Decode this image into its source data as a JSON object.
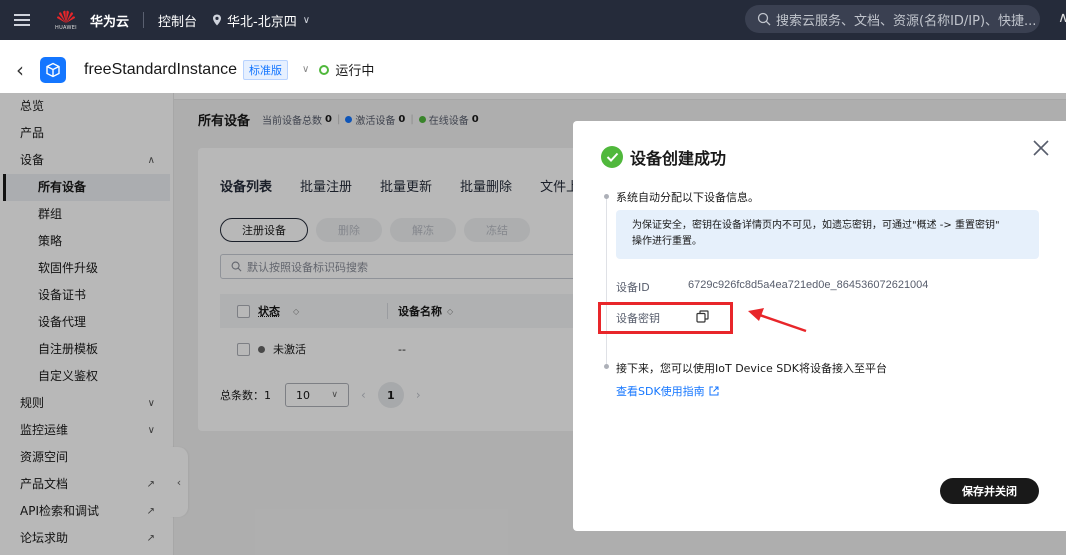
{
  "topbar": {
    "brand": "华为云",
    "logo_text": "HUAWEI",
    "console": "控制台",
    "region": "华北-北京四",
    "search_placeholder": "搜索云服务、文档、资源(名称ID/IP)、快捷...",
    "more": "∧"
  },
  "instance": {
    "name": "freeStandardInstance",
    "edition": "标准版",
    "status": "运行中"
  },
  "sidebar": {
    "items": [
      {
        "label": "总览"
      },
      {
        "label": "产品"
      },
      {
        "label": "设备",
        "indicator": "∧"
      },
      {
        "label": "所有设备"
      },
      {
        "label": "群组"
      },
      {
        "label": "策略"
      },
      {
        "label": "软固件升级"
      },
      {
        "label": "设备证书"
      },
      {
        "label": "设备代理"
      },
      {
        "label": "自注册模板"
      },
      {
        "label": "自定义鉴权"
      },
      {
        "label": "规则",
        "indicator": "∨"
      },
      {
        "label": "监控运维",
        "indicator": "∨"
      },
      {
        "label": "资源空间"
      },
      {
        "label": "产品文档",
        "indicator": "↗"
      },
      {
        "label": "API检索和调试",
        "indicator": "↗"
      },
      {
        "label": "论坛求助",
        "indicator": "↗"
      }
    ]
  },
  "main": {
    "title": "所有设备",
    "stats": {
      "total_label": "当前设备总数",
      "total": "0",
      "active_label": "激活设备",
      "active": "0",
      "online_label": "在线设备",
      "online": "0"
    },
    "tabs": [
      "设备列表",
      "批量注册",
      "批量更新",
      "批量删除",
      "文件上"
    ],
    "buttons": {
      "register": "注册设备",
      "delete": "删除",
      "unfreeze": "解冻",
      "freeze": "冻结"
    },
    "filter_placeholder": "默认按照设备标识码搜索",
    "columns": {
      "status": "状态",
      "name": "设备名称"
    },
    "row": {
      "status": "未激活",
      "name": "--"
    },
    "pager": {
      "total_label": "总条数：",
      "total": "1",
      "page_size": "10",
      "page": "1"
    }
  },
  "dialog": {
    "title": "设备创建成功",
    "step1": "系统自动分配以下设备信息。",
    "notice_line1": "为保证安全，密钥在设备详情页内不可见，如遗忘密钥，可通过\"概述 -> 重置密钥\"",
    "notice_line2": "操作进行重置。",
    "device_id_label": "设备ID",
    "device_id_value": "6729c926fc8d5a4ea721ed0e_864536072621004",
    "secret_label": "设备密钥",
    "step2": "接下来，您可以使用IoT Device SDK将设备接入至平台",
    "sdk_link": "查看SDK使用指南",
    "save_button": "保存并关闭"
  },
  "colors": {
    "topbar_bg": "#252b3a",
    "brand_blue": "#1476ff",
    "success_green": "#50b83c",
    "highlight_red": "#e8262a"
  }
}
